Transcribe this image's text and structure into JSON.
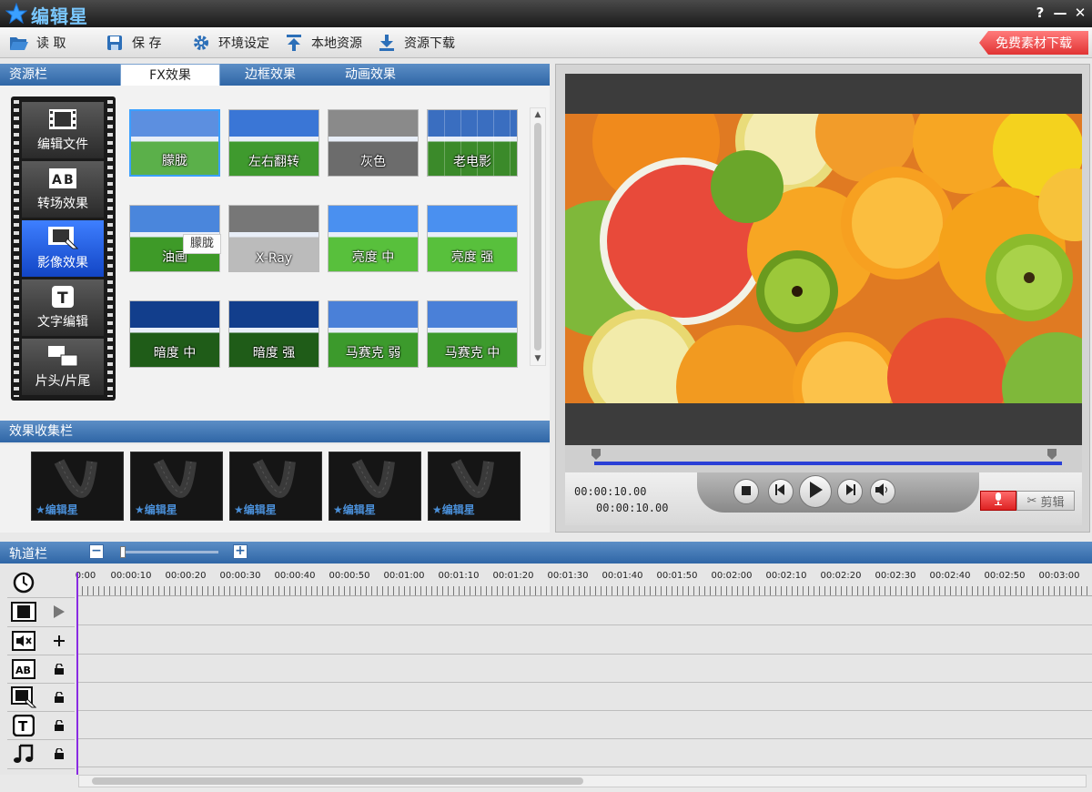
{
  "app": {
    "title": "编辑星",
    "help": "?",
    "minimize": "—",
    "close": "✕"
  },
  "toolbar": {
    "open": "读 取",
    "save": "保 存",
    "settings": "环境设定",
    "local": "本地资源",
    "download": "资源下载",
    "free": "免费素材下载"
  },
  "resource": {
    "title": "资源栏",
    "tabs": [
      "FX效果",
      "边框效果",
      "动画效果"
    ],
    "active_tab": 0,
    "categories": [
      "编辑文件",
      "转场效果",
      "影像效果",
      "文字编辑",
      "片头/片尾"
    ],
    "active_category": 2,
    "effects": [
      "朦胧",
      "左右翻转",
      "灰色",
      "老电影",
      "油画",
      "X-Ray",
      "亮度 中",
      "亮度 强",
      "暗度 中",
      "暗度 强",
      "马赛克 弱",
      "马赛克 中"
    ],
    "selected_effect": 0,
    "tooltip": "朦胧"
  },
  "collect": {
    "title": "效果收集栏",
    "tile_logo": "编辑星",
    "count": 5
  },
  "preview": {
    "time_current": "00:00:10.00",
    "time_total": "00:00:10.00",
    "cut_label": "剪辑"
  },
  "timeline": {
    "title": "轨道栏",
    "zoom_minus": "−",
    "zoom_plus": "+",
    "ruler": [
      "0:00",
      "00:00:10",
      "00:00:20",
      "00:00:30",
      "00:00:40",
      "00:00:50",
      "00:01:00",
      "00:01:10",
      "00:01:20",
      "00:01:30",
      "00:01:40",
      "00:01:50",
      "00:02:00",
      "00:02:10",
      "00:02:20",
      "00:02:30",
      "00:02:40",
      "00:02:50",
      "00:03:00"
    ],
    "tracks": [
      "clock-icon",
      "film-icon",
      "audio-mute-icon",
      "transition-ab-icon",
      "image-effect-icon",
      "text-icon",
      "music-icon"
    ]
  }
}
